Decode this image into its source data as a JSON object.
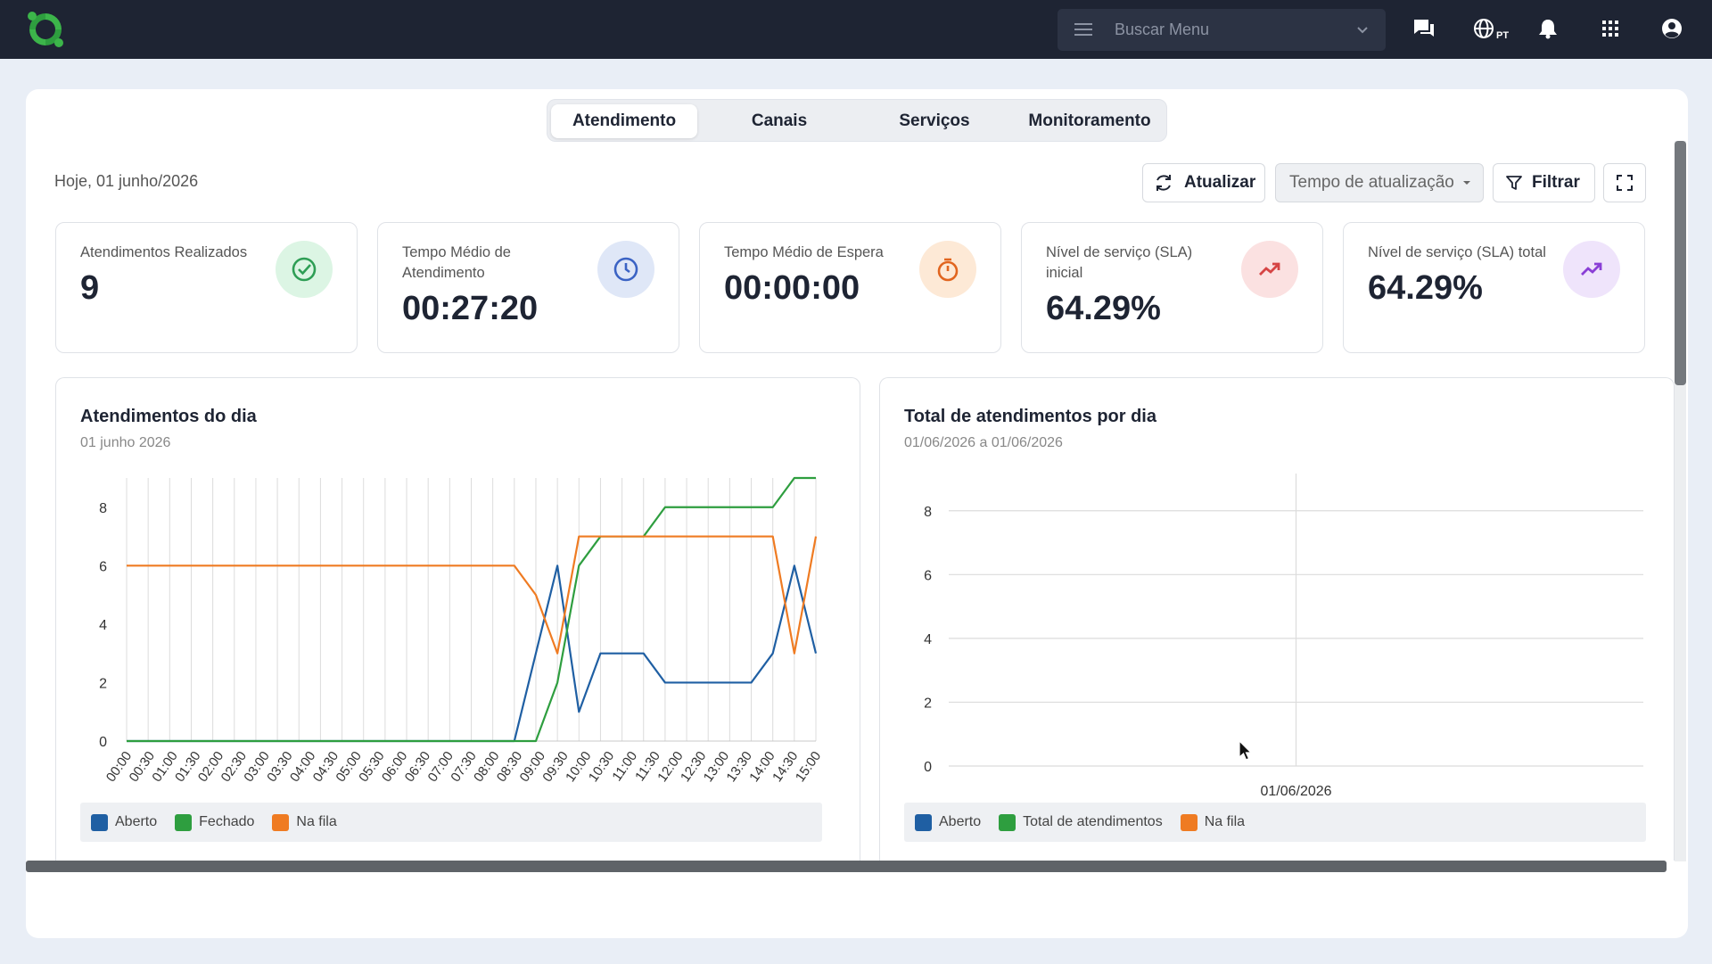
{
  "header": {
    "search_placeholder": "Buscar Menu",
    "language_code": "PT"
  },
  "tabs": [
    {
      "label": "Atendimento",
      "active": true
    },
    {
      "label": "Canais",
      "active": false
    },
    {
      "label": "Serviços",
      "active": false
    },
    {
      "label": "Monitoramento",
      "active": false
    }
  ],
  "toolbar": {
    "date_label": "Hoje, 01 junho/2026",
    "refresh_label": "Atualizar",
    "refresh_interval_label": "Tempo de atualização",
    "filter_label": "Filtrar"
  },
  "kpis": [
    {
      "label": "Atendimentos Realizados",
      "value": "9",
      "icon": "check-circle-icon",
      "icon_bg": "#dcf5e4",
      "icon_color": "#2e9e55"
    },
    {
      "label": "Tempo Médio de Atendimento",
      "value": "00:27:20",
      "icon": "clock-icon",
      "icon_bg": "#dfe7f7",
      "icon_color": "#3b63c4"
    },
    {
      "label": "Tempo Médio de Espera",
      "value": "00:00:00",
      "icon": "stopwatch-icon",
      "icon_bg": "#fde9d6",
      "icon_color": "#e1651f"
    },
    {
      "label": "Nível de serviço (SLA) inicial",
      "value": "64.29%",
      "icon": "trending-up-icon",
      "icon_bg": "#fbe1e1",
      "icon_color": "#d64545"
    },
    {
      "label": "Nível de serviço (SLA) total",
      "value": "64.29%",
      "icon": "trending-up-icon",
      "icon_bg": "#efe4fb",
      "icon_color": "#8a3fd6"
    }
  ],
  "charts": {
    "daily": {
      "title": "Atendimentos do dia",
      "subtitle": "01 junho 2026"
    },
    "per_day": {
      "title": "Total de atendimentos por dia",
      "subtitle": "01/06/2026 a 01/06/2026"
    }
  },
  "chart_data": [
    {
      "type": "line",
      "title": "Atendimentos do dia",
      "subtitle": "01 junho 2026",
      "x": [
        "00:00",
        "00:30",
        "01:00",
        "01:30",
        "02:00",
        "02:30",
        "03:00",
        "03:30",
        "04:00",
        "04:30",
        "05:00",
        "05:30",
        "06:00",
        "06:30",
        "07:00",
        "07:30",
        "08:00",
        "08:30",
        "09:00",
        "09:30",
        "10:00",
        "10:30",
        "11:00",
        "11:30",
        "12:00",
        "12:30",
        "13:00",
        "13:30",
        "14:00",
        "14:30",
        "15:00"
      ],
      "x_ticks": [
        "00:00",
        "00:30",
        "01:00",
        "01:30",
        "02:00",
        "02:30",
        "03:00",
        "03:30",
        "04:00",
        "04:30",
        "05:00",
        "05:30",
        "06:00",
        "06:30",
        "07:00",
        "07:30",
        "08:00",
        "08:30",
        "09:00",
        "09:30",
        "10:00",
        "10:30",
        "11:00",
        "11:30",
        "12:00",
        "12:30",
        "13:00",
        "13:30",
        "14:00",
        "14:30",
        "15:00"
      ],
      "y_ticks": [
        0,
        2,
        4,
        6,
        8
      ],
      "ylim": [
        0,
        9
      ],
      "grid": true,
      "legend_position": "bottom",
      "series": [
        {
          "name": "Aberto",
          "color": "#1f5fa3",
          "values": [
            0,
            0,
            0,
            0,
            0,
            0,
            0,
            0,
            0,
            0,
            0,
            0,
            0,
            0,
            0,
            0,
            0,
            0,
            0,
            3,
            6,
            1,
            3,
            3,
            3,
            2,
            2,
            2,
            2,
            2,
            3,
            6,
            3
          ]
        },
        {
          "name": "Fechado",
          "color": "#2e9e3f",
          "values": [
            0,
            0,
            0,
            0,
            0,
            0,
            0,
            0,
            0,
            0,
            0,
            0,
            0,
            0,
            0,
            0,
            0,
            0,
            0,
            0,
            2,
            6,
            7,
            7,
            7,
            8,
            8,
            8,
            8,
            8,
            8,
            9,
            9
          ]
        },
        {
          "name": "Na fila",
          "color": "#ef7b22",
          "values": [
            6,
            6,
            6,
            6,
            6,
            6,
            6,
            6,
            6,
            6,
            6,
            6,
            6,
            6,
            6,
            6,
            6,
            6,
            6,
            5,
            3,
            7,
            7,
            7,
            7,
            7,
            7,
            7,
            7,
            7,
            7,
            3,
            7
          ]
        }
      ]
    },
    {
      "type": "line",
      "title": "Total de atendimentos por dia",
      "subtitle": "01/06/2026 a 01/06/2026",
      "x": [
        "01/06/2026"
      ],
      "y_ticks": [
        0,
        2,
        4,
        6,
        8
      ],
      "ylim": [
        0,
        9
      ],
      "grid": true,
      "legend_position": "bottom",
      "series": [
        {
          "name": "Aberto",
          "color": "#1f5fa3",
          "values": []
        },
        {
          "name": "Total de atendimentos",
          "color": "#2e9e3f",
          "values": []
        },
        {
          "name": "Na fila",
          "color": "#ef7b22",
          "values": []
        }
      ]
    }
  ]
}
